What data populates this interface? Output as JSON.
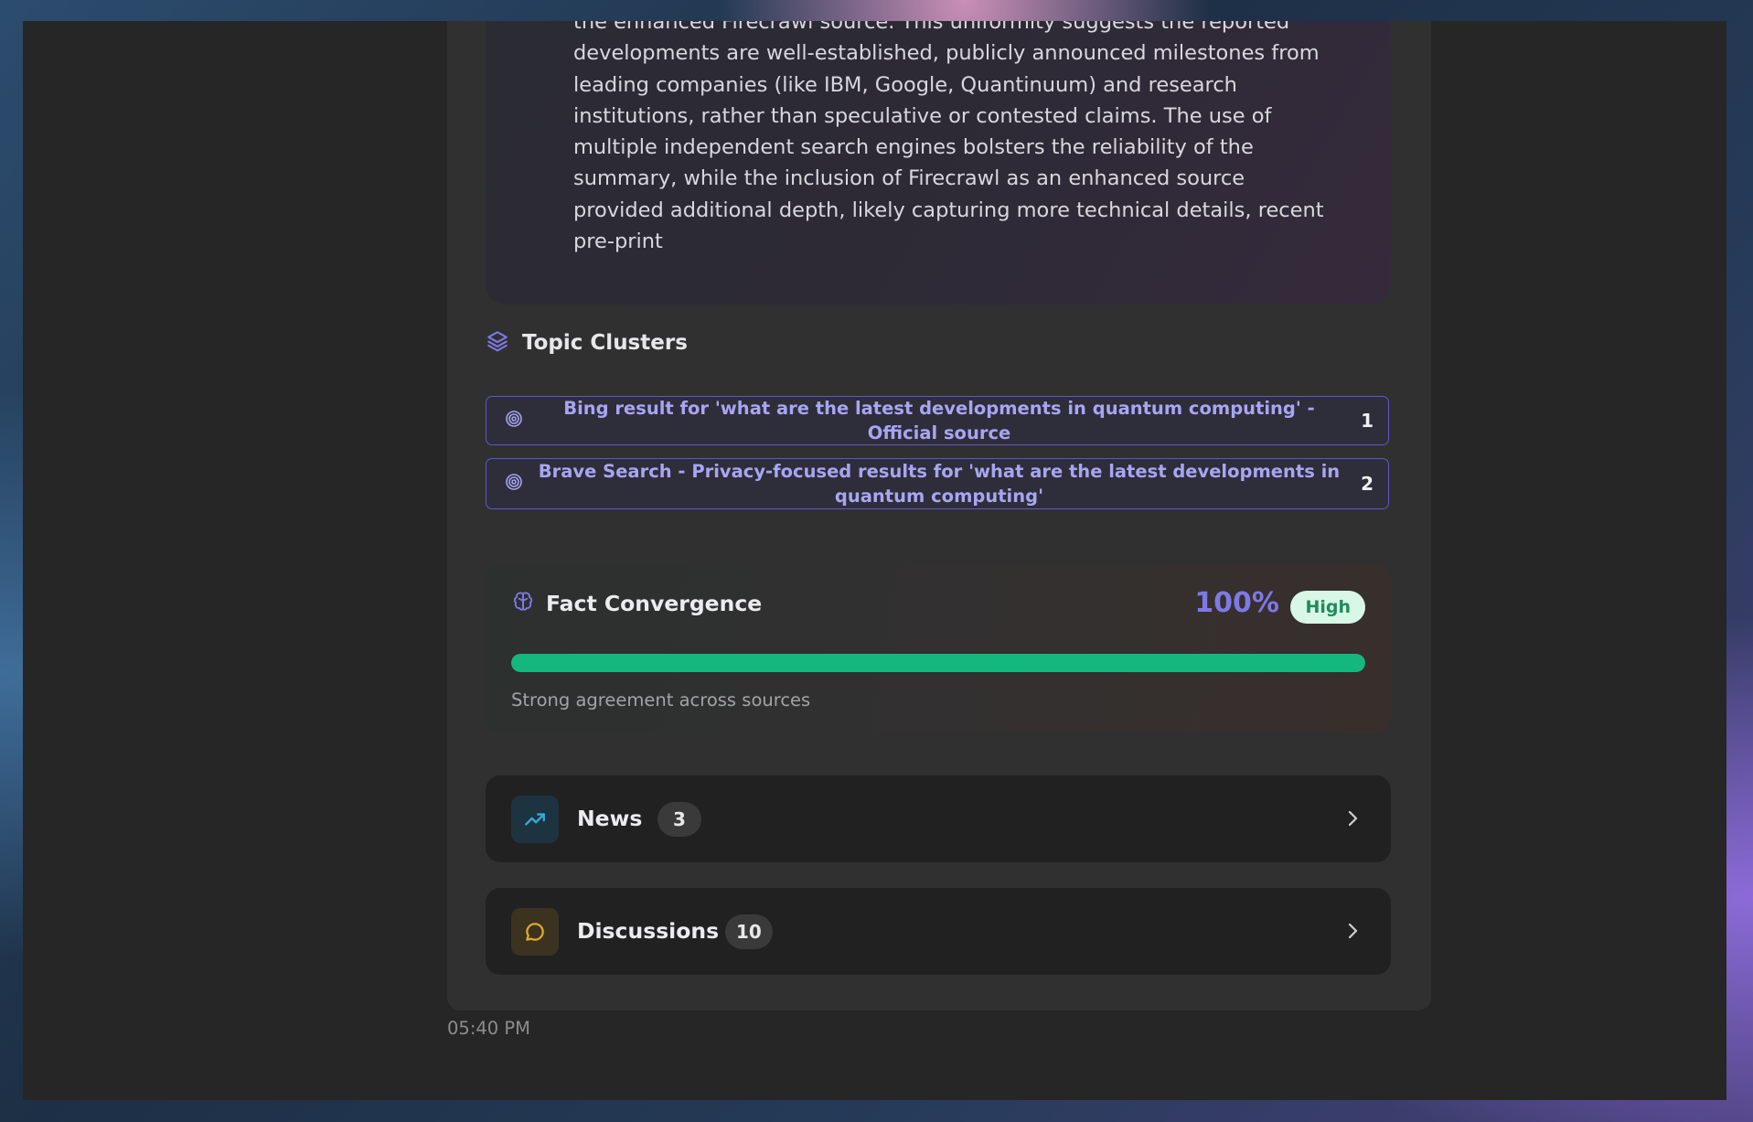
{
  "reasoning": {
    "lines": [
      "the enhanced Firecrawl source. This uniformity suggests the reported",
      "developments are well-established, publicly announced milestones from",
      "leading companies (like IBM, Google, Quantinuum) and research",
      "institutions, rather than speculative or contested claims. The use of",
      "multiple independent search engines bolsters the reliability of the",
      "summary, while the inclusion of Firecrawl as an enhanced source",
      "provided additional depth, likely capturing more technical details, recent",
      "pre-print"
    ]
  },
  "topic_clusters": {
    "title": "Topic Clusters",
    "icon": "layers-icon",
    "items": [
      {
        "label": "Bing result for 'what are the latest developments in quantum computing' - Official source",
        "count": "1"
      },
      {
        "label": "Brave Search - Privacy-focused results for 'what are the latest developments in quantum computing'",
        "count": "2"
      }
    ]
  },
  "fact_convergence": {
    "title": "Fact Convergence",
    "icon": "brain-icon",
    "percent_label": "100%",
    "percent_value": 100,
    "level": "High",
    "note": "Strong agreement across sources",
    "bar_color": "#14b87e"
  },
  "sections": [
    {
      "title": "News",
      "count": "3",
      "icon": "trending-up-icon",
      "icon_color": "#38a9d6",
      "icon_bg": "#1d3340"
    },
    {
      "title": "Discussions",
      "count": "10",
      "icon": "message-circle-icon",
      "icon_color": "#e0a92a",
      "icon_bg": "#3b3220"
    }
  ],
  "timestamp": "05:40 PM",
  "colors": {
    "accent": "#7f78e6",
    "cluster_text": "#a8a5f2",
    "success": "#14b87e"
  }
}
